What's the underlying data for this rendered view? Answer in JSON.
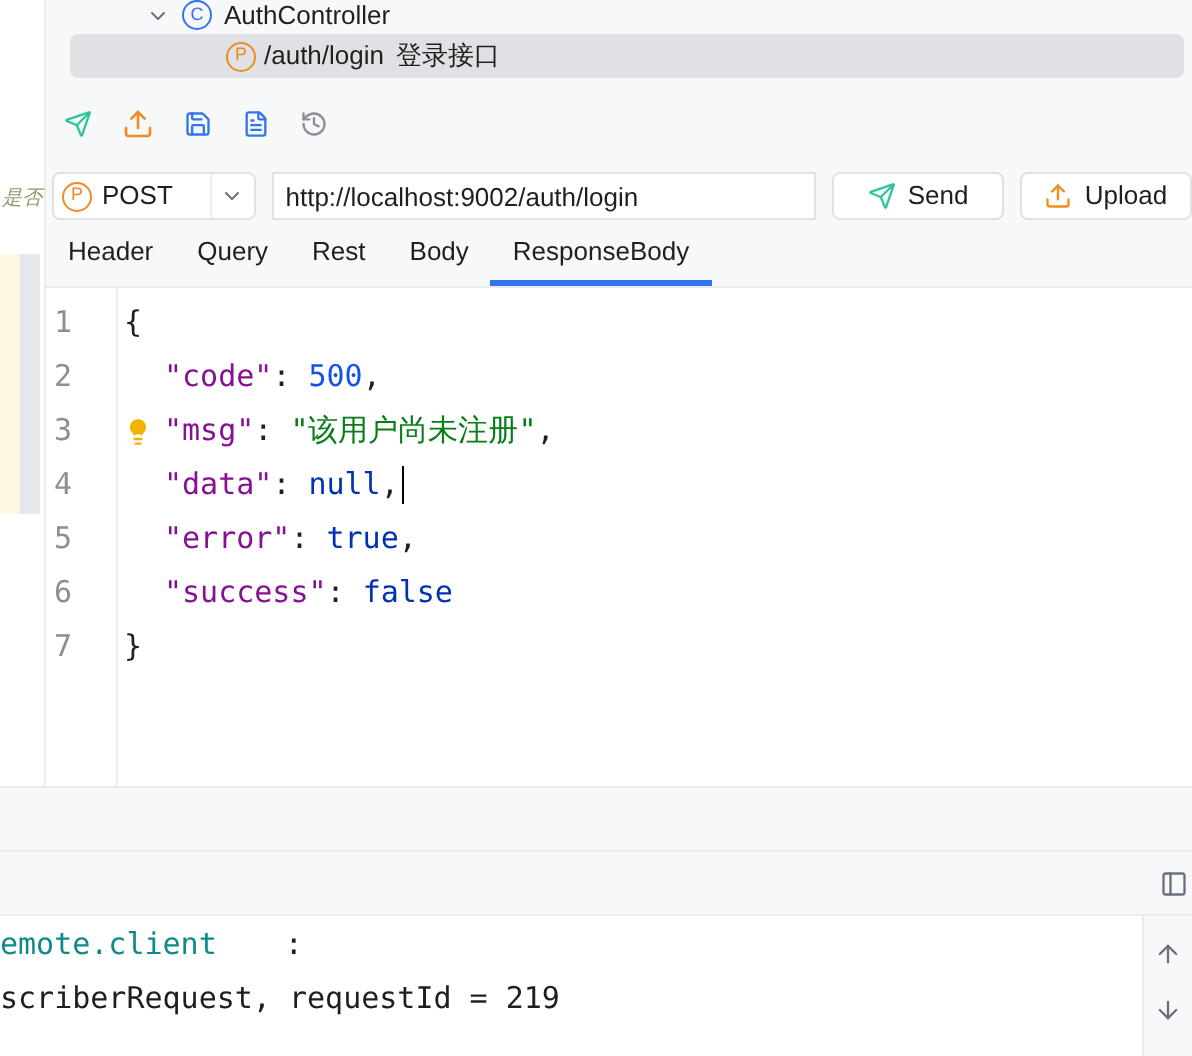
{
  "tree": [
    {
      "label": "AuthController",
      "icon": "C",
      "expanded": true,
      "children": [
        {
          "method": "P",
          "label": "/auth/login",
          "description": "登录接口",
          "selected": true
        }
      ]
    }
  ],
  "editor_fragment": "是否",
  "request": {
    "method": "POST",
    "method_badge": "P",
    "url": "http://localhost:9002/auth/login",
    "buttons": [
      {
        "kind": "send",
        "label": "Send"
      },
      {
        "kind": "upload",
        "label": "Upload"
      }
    ]
  },
  "tabs": [
    {
      "label": "Header",
      "selected": false
    },
    {
      "label": "Query",
      "selected": false
    },
    {
      "label": "Rest",
      "selected": false
    },
    {
      "label": "Body",
      "selected": false
    },
    {
      "label": "ResponseBody",
      "selected": true
    }
  ],
  "response_lines": [
    {
      "kind": "brace",
      "text": "{"
    },
    {
      "kind": "pair",
      "key": "\"code\"",
      "colon": ":",
      "value": {
        "kind": "number",
        "text": "500"
      },
      "end": ","
    },
    {
      "kind": "pair",
      "key": "\"msg\"",
      "colon": ":",
      "value": {
        "kind": "string",
        "text": "\"该用户尚未注册\""
      },
      "end": ",",
      "hint": true
    },
    {
      "kind": "pair",
      "key": "\"data\"",
      "colon": ":",
      "value": {
        "kind": "keyword",
        "text": "null"
      },
      "end": ",",
      "caret": true
    },
    {
      "kind": "pair",
      "key": "\"error\"",
      "colon": ":",
      "value": {
        "kind": "keyword",
        "text": "true"
      },
      "end": ","
    },
    {
      "kind": "pair",
      "key": "\"success\"",
      "colon": ":",
      "value": {
        "kind": "keyword",
        "text": "false"
      }
    },
    {
      "kind": "brace",
      "text": "}"
    }
  ],
  "line_numbers": [
    "1",
    "2",
    "3",
    "4",
    "5",
    "6",
    "7"
  ],
  "console": [
    {
      "kind": "logger",
      "text": "emote.client",
      "suffix": ":"
    },
    {
      "kind": "plain",
      "text": "scriberRequest, requestId = 219"
    }
  ]
}
